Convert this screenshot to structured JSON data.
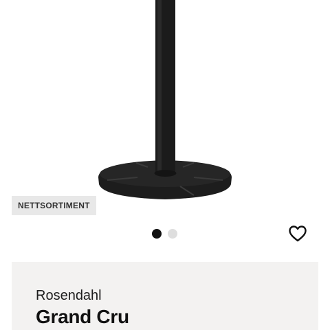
{
  "product": {
    "badge": "NETTSORTIMENT",
    "brand": "Rosendahl",
    "name": "Grand Cru",
    "image_icon": "kitchen-roll-holder-image"
  },
  "carousel": {
    "active_index": 0,
    "dots": [
      "image-1",
      "image-2"
    ]
  },
  "wishlist": {
    "icon": "heart-outline-icon"
  },
  "colors": {
    "product": "#1d1d1d",
    "badge_bg": "#e8e8e8",
    "card_bg": "#f3f2f1",
    "dot_active": "#111111",
    "dot_inactive": "#dedede"
  }
}
